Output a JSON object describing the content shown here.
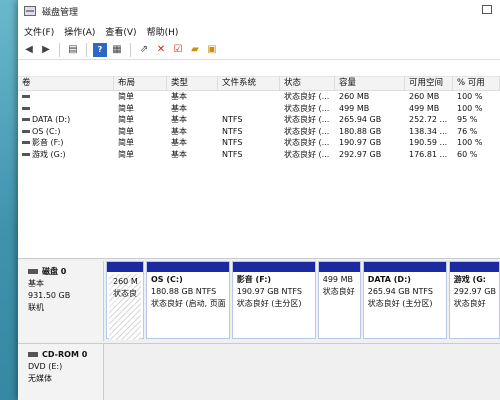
{
  "window": {
    "title": "磁盘管理"
  },
  "menu": [
    "文件(F)",
    "操作(A)",
    "查看(V)",
    "帮助(H)"
  ],
  "toolbar": [
    "back-icon",
    "forward-icon",
    "list-icon",
    "help-icon",
    "properties-icon",
    "link-icon",
    "delete-icon",
    "check-icon",
    "folder-icon",
    "new-icon"
  ],
  "table": {
    "headers": [
      "卷",
      "布局",
      "类型",
      "文件系统",
      "状态",
      "容量",
      "可用空间",
      "% 可用"
    ],
    "rows": [
      [
        "",
        "简单",
        "基本",
        "",
        "状态良好 (...",
        "260 MB",
        "260 MB",
        "100 %"
      ],
      [
        "",
        "简单",
        "基本",
        "",
        "状态良好 (...",
        "499 MB",
        "499 MB",
        "100 %"
      ],
      [
        "DATA (D:)",
        "简单",
        "基本",
        "NTFS",
        "状态良好 (...",
        "265.94 GB",
        "252.72 ...",
        "95 %"
      ],
      [
        "OS (C:)",
        "简单",
        "基本",
        "NTFS",
        "状态良好 (...",
        "180.88 GB",
        "138.34 ...",
        "76 %"
      ],
      [
        "影音 (F:)",
        "简单",
        "基本",
        "NTFS",
        "状态良好 (...",
        "190.97 GB",
        "190.59 ...",
        "100 %"
      ],
      [
        "游戏 (G:)",
        "简单",
        "基本",
        "NTFS",
        "状态良好 (...",
        "292.97 GB",
        "176.81 ...",
        "60 %"
      ]
    ]
  },
  "disk0": {
    "name": "磁盘 0",
    "type": "基本",
    "size": "931.50 GB",
    "status": "联机",
    "partitions": [
      {
        "name": "",
        "size": "260 MI",
        "status": "状态良",
        "hatched": true
      },
      {
        "name": "OS (C:)",
        "size": "180.88 GB NTFS",
        "status": "状态良好 (启动, 页面"
      },
      {
        "name": "影音 (F:)",
        "size": "190.97 GB NTFS",
        "status": "状态良好 (主分区)"
      },
      {
        "name": "",
        "size": "499 MB",
        "status": "状态良好"
      },
      {
        "name": "DATA (D:)",
        "size": "265.94 GB NTFS",
        "status": "状态良好 (主分区)"
      },
      {
        "name": "游戏 (G:",
        "size": "292.97 GB",
        "status": "状态良好"
      }
    ]
  },
  "cdrom0": {
    "name": "CD-ROM 0",
    "type": "DVD (E:)",
    "status": "无媒体"
  }
}
